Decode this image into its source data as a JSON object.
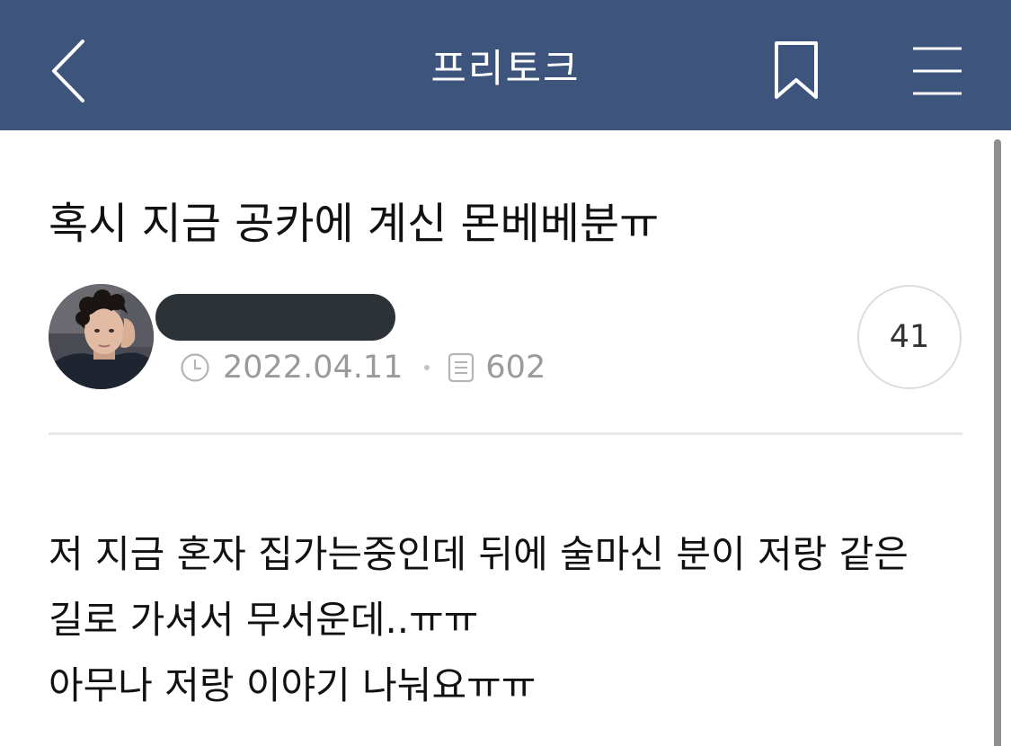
{
  "header": {
    "title": "프리토크",
    "icons": {
      "back": "back-chevron-icon",
      "bookmark": "bookmark-icon",
      "menu": "hamburger-menu-icon"
    },
    "background_color": "#3d547d"
  },
  "post": {
    "title": "혹시 지금 공카에 계신 몬베베분ㅠ",
    "author": {
      "avatar": "profile-photo",
      "name_redacted": true
    },
    "date": "2022.04.11",
    "views": "602",
    "comment_count": "41",
    "body_lines": [
      "저 지금 혼자 집가는중인데 뒤에 술마신 분이 저랑 같은",
      "길로 가셔서 무서운데..ㅠㅠ",
      "아무나 저랑 이야기 나눠요ㅠㅠ"
    ]
  }
}
